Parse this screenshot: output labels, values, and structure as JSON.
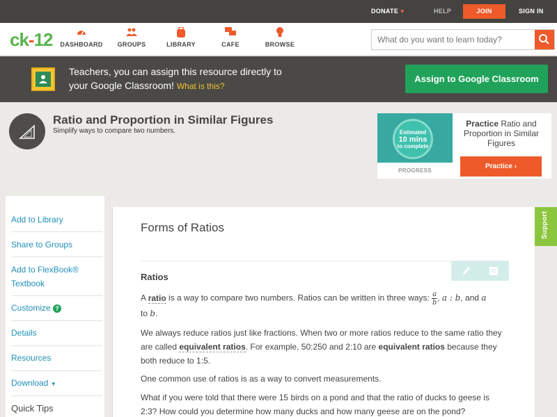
{
  "topbar": {
    "donate": "DONATE",
    "help": "HELP",
    "join": "JOIN",
    "signin": "SIGN IN"
  },
  "logo": {
    "part1": "ck",
    "dash": "-",
    "part2": "12"
  },
  "nav": [
    {
      "label": "DASHBOARD",
      "icon": "gauge-icon"
    },
    {
      "label": "GROUPS",
      "icon": "people-icon"
    },
    {
      "label": "LIBRARY",
      "icon": "backpack-icon"
    },
    {
      "label": "CAFE",
      "icon": "chat-bubbles-icon"
    },
    {
      "label": "BROWSE",
      "icon": "lightbulb-icon"
    }
  ],
  "search": {
    "placeholder": "What do you want to learn today?"
  },
  "banner": {
    "line1": "Teachers, you can assign this resource directly to",
    "line2": "your Google Classroom!",
    "what": "What is this?",
    "button": "Assign to Google Classroom"
  },
  "header": {
    "title": "Ratio and Proportion in Similar Figures",
    "subtitle": "Simplify ways to compare two numbers."
  },
  "practice": {
    "est1": "Estimated",
    "est2": "10 mins",
    "est3": "to complete",
    "progress": "PROGRESS",
    "bold": "Practice",
    "rest": " Ratio and Proportion in Similar Figures",
    "button": "Practice"
  },
  "sidebar": {
    "items": [
      "Add to Library",
      "Share to Groups",
      "Add to FlexBook® Textbook",
      "Customize",
      "Details",
      "Resources",
      "Download"
    ],
    "quicktips": "Quick Tips"
  },
  "content": {
    "title": "Forms of Ratios",
    "heading": "Ratios",
    "p1a": "A ",
    "p1term": "ratio",
    "p1b": " is a way to compare two numbers. Ratios can be written in three ways: ",
    "frac_num": "a",
    "frac_den": "b",
    "p1c": ", ",
    "p1d": "a : b",
    "p1e": ", and ",
    "p1f": "a",
    "p1g": "to ",
    "p1h": "b",
    "p1i": ".",
    "p2a": "We always reduce ratios just like fractions. When two or more ratios reduce to the same ratio they are called ",
    "p2term": "equivalent ratios",
    "p2b": ". For example, 50:250 and 2:10 are ",
    "p2bold": "equivalent ratios",
    "p2c": " because they both reduce to 1:5.",
    "p3": "One common use of ratios is as a way to convert measurements.",
    "p4": "What if you were told that there were 15 birds on a pond and that the ratio of ducks to geese is 2:3? How could you determine how many ducks and how many geese are on the pond?"
  },
  "support": "Support",
  "colors": {
    "accent": "#ee5a2a",
    "green": "#20a25a",
    "link": "#1f8fb8"
  }
}
